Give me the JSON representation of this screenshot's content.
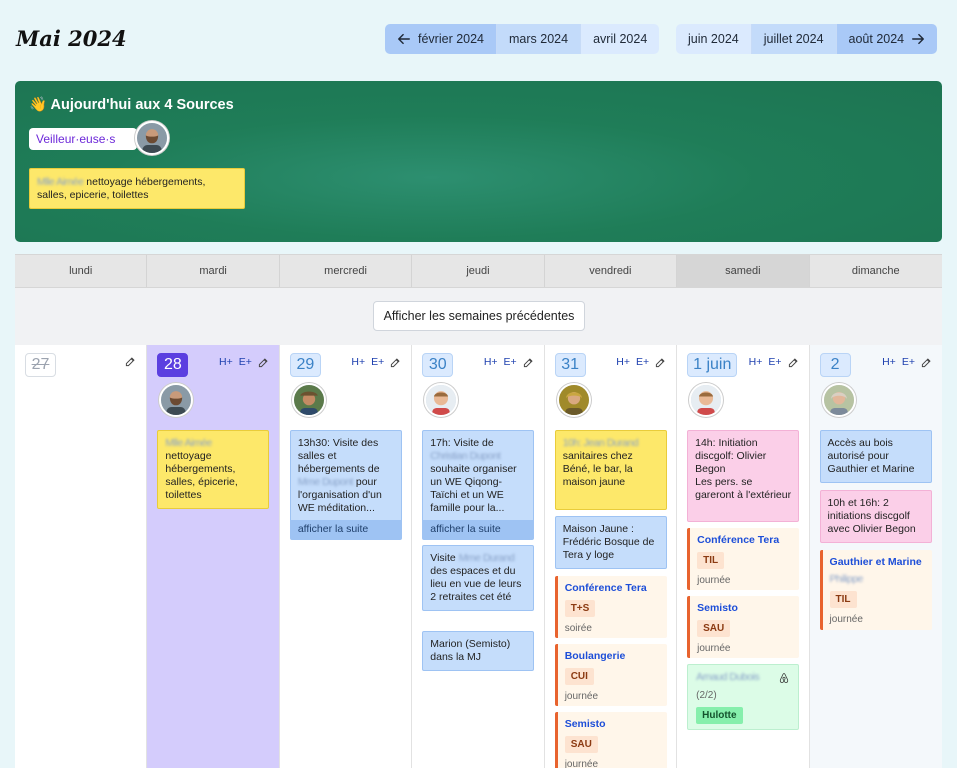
{
  "title": "Mai 2024",
  "nav": {
    "left": [
      "février 2024",
      "mars 2024",
      "avril 2024"
    ],
    "right": [
      "juin 2024",
      "juillet 2024",
      "août 2024"
    ]
  },
  "banner": {
    "title": "👋 Aujourd'hui aux 4 Sources",
    "watcher_label": "Veilleur·euse·s",
    "note_blur": "Mlle Aimée",
    "note_text": "nettoyage hébergements, salles, epicerie, toilettes"
  },
  "weekdays": [
    "lundi",
    "mardi",
    "mercredi",
    "jeudi",
    "vendredi",
    "samedi",
    "dimanche"
  ],
  "prev_weeks_label": "Afficher les semaines précédentes",
  "actions": {
    "h": "H+",
    "e": "E+"
  },
  "colors": {
    "today": "#5b3fe0",
    "accent": "#1d4ed8",
    "banner": "#1f7d58"
  },
  "days": {
    "mon": {
      "date": "27"
    },
    "tue": {
      "date": "28",
      "card1_blur": "Mlle Aimée",
      "card1_text": "nettoyage hébergements, salles, épicerie, toilettes"
    },
    "wed": {
      "date": "29",
      "card1_a": "13h30: Visite des salles et hébergements de",
      "card1_blur": "Mme Dupont",
      "card1_b": "pour l'organisation d'un WE méditation...",
      "more": "afficher la suite"
    },
    "thu": {
      "date": "30",
      "card1_a": "17h: Visite de",
      "card1_blur": "Christian Dupont",
      "card1_b": "souhaite organiser un WE Qiqong-Taïchi et un WE famille pour la...",
      "more": "afficher la suite",
      "card2_a": "Visite",
      "card2_blur": "Mme Durand",
      "card2_b": "des espaces et du lieu en vue de leurs 2 retraites cet été",
      "card3": "Marion (Semisto) dans la MJ"
    },
    "fri": {
      "date": "31",
      "card1_blur": "10h: Jean Durand",
      "card1_text": "sanitaires chez Béné, le bar, la maison jaune",
      "card2": "Maison Jaune : Frédéric Bosque de Tera y loge",
      "ev1_title": "Conférence Tera",
      "ev1_tag": "T+S",
      "ev1_sub": "soirée",
      "ev2_title": "Boulangerie",
      "ev2_tag": "CUI",
      "ev2_sub": "journée",
      "ev3_title": "Semisto",
      "ev3_tag": "SAU",
      "ev3_sub": "journée"
    },
    "sat": {
      "date": "1 juin",
      "card1": "14h: Initiation discgolf: Olivier Begon",
      "card1_b": "Les pers. se gareront à l'extérieur",
      "ev1_title": "Conférence Tera",
      "ev1_tag": "TIL",
      "ev1_sub": "journée",
      "ev2_title": "Semisto",
      "ev2_tag": "SAU",
      "ev2_sub": "journée",
      "green_blur": "Arnaud Dubois",
      "green_count": "(2/2)",
      "green_tag": "Hulotte"
    },
    "sun": {
      "date": "2",
      "card1": "Accès au bois autorisé pour Gauthier et Marine",
      "card2": "10h et 16h: 2 initiations discgolf avec Olivier Begon",
      "ev1_title": "Gauthier et Marine",
      "ev1_blur": "Philippe",
      "ev1_tag": "TIL",
      "ev1_sub": "journée"
    }
  }
}
